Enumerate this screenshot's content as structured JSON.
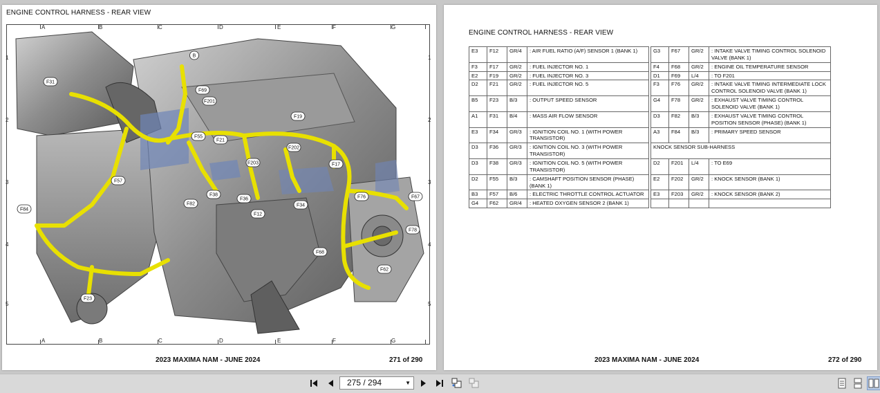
{
  "left_page": {
    "title": "ENGINE CONTROL HARNESS - REAR VIEW",
    "footer_doc": "2023 MAXIMA NAM - JUNE 2024",
    "footer_page": "271 of 290",
    "grid_columns": [
      "A",
      "B",
      "C",
      "D",
      "E",
      "F",
      "G"
    ],
    "grid_rows": [
      "1",
      "2",
      "3",
      "4",
      "5"
    ],
    "callouts": [
      "B",
      "F31",
      "F69",
      "F201",
      "F19",
      "F55",
      "F21",
      "F202",
      "F203",
      "F17",
      "F57",
      "F38",
      "F36",
      "F34",
      "F82",
      "F12",
      "F76",
      "F67",
      "F84",
      "F78",
      "F68",
      "F62",
      "F23"
    ]
  },
  "right_page": {
    "title": "ENGINE CONTROL HARNESS - REAR VIEW",
    "footer_doc": "2023 MAXIMA NAM - JUNE 2024",
    "footer_page": "272 of 290",
    "rows": [
      {
        "l": [
          "E3",
          "F12",
          "GR/4",
          ": AIR FUEL RATIO (A/F) SENSOR 1 (BANK 1)"
        ],
        "r": [
          "G3",
          "F67",
          "GR/2",
          ": INTAKE VALVE TIMING CONTROL SOLENOID VALVE (BANK 1)"
        ]
      },
      {
        "l": [
          "F3",
          "F17",
          "GR/2",
          ": FUEL INJECTOR NO. 1"
        ],
        "r": [
          "F4",
          "F68",
          "GR/2",
          ": ENGINE OIL TEMPERATURE SENSOR"
        ]
      },
      {
        "l": [
          "E2",
          "F19",
          "GR/2",
          ": FUEL INJECTOR NO. 3"
        ],
        "r": [
          "D1",
          "F69",
          "L/4",
          ": TO F201"
        ]
      },
      {
        "l": [
          "D2",
          "F21",
          "GR/2",
          ": FUEL INJECTOR NO. 5"
        ],
        "r": [
          "F3",
          "F76",
          "GR/2",
          ": INTAKE VALVE TIMING INTERMEDIATE LOCK CONTROL SOLENOID VALVE (BANK 1)"
        ]
      },
      {
        "l": [
          "B5",
          "F23",
          "B/3",
          ": OUTPUT SPEED SENSOR"
        ],
        "r": [
          "G4",
          "F78",
          "GR/2",
          ": EXHAUST VALVE TIMING CONTROL SOLENOID VALVE (BANK 1)"
        ]
      },
      {
        "l": [
          "A1",
          "F31",
          "B/4",
          ": MASS AIR FLOW SENSOR"
        ],
        "r": [
          "D3",
          "F82",
          "B/3",
          ": EXHAUST VALVE TIMING CONTROL POSITION SENSOR (PHASE) (BANK 1)"
        ]
      },
      {
        "l": [
          "E3",
          "F34",
          "GR/3",
          ": IGNITION COIL NO. 1 (WITH POWER TRANSISTOR)"
        ],
        "r": [
          "A3",
          "F84",
          "B/3",
          ": PRIMARY SPEED SENSOR"
        ]
      },
      {
        "l": [
          "D3",
          "F36",
          "GR/3",
          ": IGNITION COIL NO. 3 (WITH POWER TRANSISTOR)"
        ],
        "header": "KNOCK SENSOR SUB-HARNESS"
      },
      {
        "l": [
          "D3",
          "F38",
          "GR/3",
          ": IGNITION COIL NO. 5 (WITH POWER TRANSISTOR)"
        ],
        "r": [
          "D2",
          "F201",
          "L/4",
          ": TO E69"
        ]
      },
      {
        "l": [
          "D2",
          "F55",
          "B/3",
          ": CAMSHAFT POSITION SENSOR (PHASE) (BANK 1)"
        ],
        "r": [
          "E2",
          "F202",
          "GR/2",
          ": KNOCK SENSOR (BANK 1)"
        ]
      },
      {
        "l": [
          "B3",
          "F57",
          "B/6",
          ": ELECTRIC THROTTLE CONTROL ACTUATOR"
        ],
        "r": [
          "E3",
          "F203",
          "GR/2",
          ": KNOCK SENSOR (BANK 2)"
        ]
      },
      {
        "l": [
          "G4",
          "F62",
          "GR/4",
          ": HEATED OXYGEN SENSOR 2 (BANK 1)"
        ],
        "r": [
          "",
          "",
          "",
          ""
        ]
      }
    ]
  },
  "toolbar": {
    "page_display": "275 / 294"
  },
  "colors": {
    "harness": "#e8e000",
    "background": "#c8c8c8"
  }
}
